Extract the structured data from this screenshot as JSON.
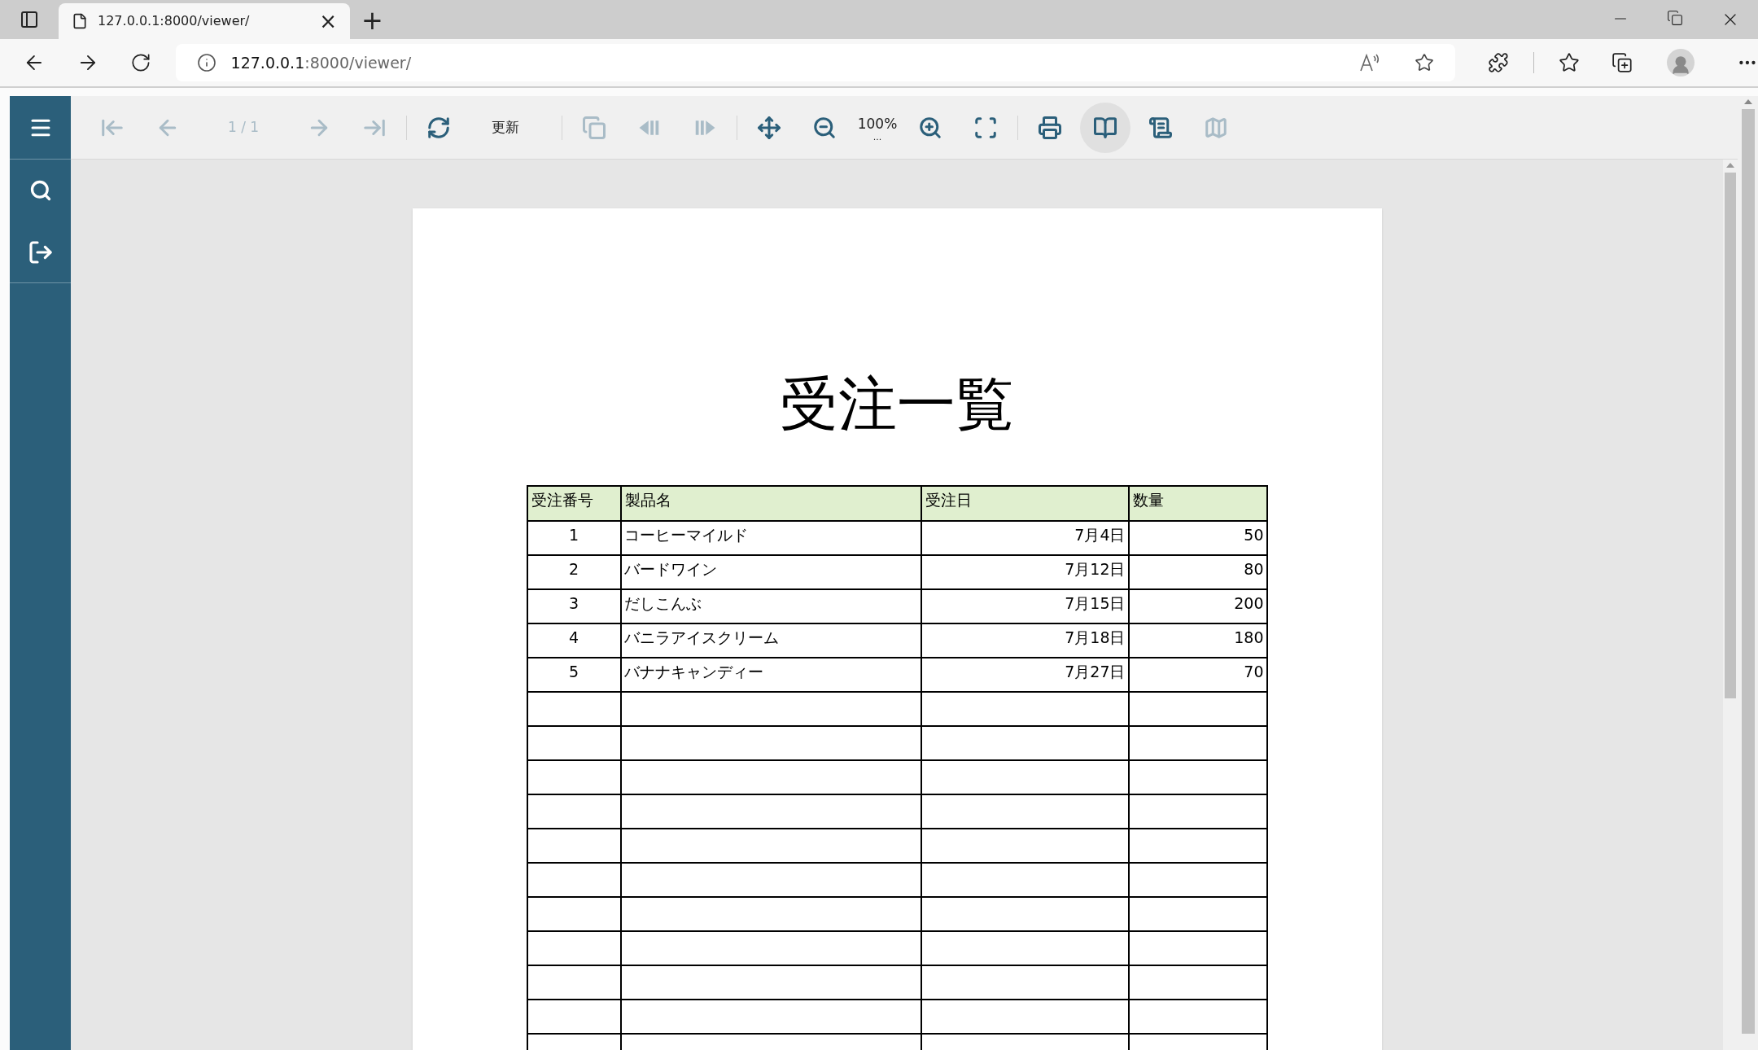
{
  "browser": {
    "tab_title": "127.0.0.1:8000/viewer/",
    "tab_close": "×",
    "new_tab": "+",
    "address": {
      "host": "127.0.0.1",
      "path": ":8000/viewer/"
    }
  },
  "toolbar_groups": [
    [
      {
        "kind": "icon",
        "disabled": true
      },
      {
        "kind": "icon",
        "disabled": true
      },
      {
        "kind": "page",
        "text": "1 / 1",
        "disabled": true
      },
      {
        "kind": "icon",
        "disabled": true
      },
      {
        "kind": "icon",
        "disabled": true
      }
    ],
    [
      {
        "kind": "icon",
        "disabled": false
      },
      {
        "kind": "label",
        "text": "更新"
      }
    ],
    [
      {
        "kind": "icon",
        "disabled": true
      },
      {
        "kind": "icon",
        "disabled": true
      },
      {
        "kind": "icon",
        "disabled": true
      }
    ],
    [
      {
        "kind": "icon",
        "disabled": false
      },
      {
        "kind": "icon",
        "disabled": false
      },
      {
        "kind": "zoom",
        "text": "100%",
        "menu": "..."
      },
      {
        "kind": "icon",
        "disabled": false
      },
      {
        "kind": "icon",
        "disabled": false
      }
    ],
    [
      {
        "kind": "icon",
        "disabled": false,
        "selected": false
      },
      {
        "kind": "icon",
        "disabled": false,
        "selected": true
      },
      {
        "kind": "icon",
        "disabled": false,
        "selected": false
      },
      {
        "kind": "icon",
        "disabled": true,
        "selected": false
      }
    ]
  ],
  "report": {
    "title": "受注一覧",
    "columns": [
      {
        "label": "受注番号"
      },
      {
        "label": "製品名"
      },
      {
        "label": "受注日"
      },
      {
        "label": "数量"
      }
    ],
    "rows": [
      [
        "1",
        "コーヒーマイルド",
        "7月4日",
        "50"
      ],
      [
        "2",
        "バードワイン",
        "7月12日",
        "80"
      ],
      [
        "3",
        "だしこんぶ",
        "7月15日",
        "200"
      ],
      [
        "4",
        "バニラアイスクリーム",
        "7月18日",
        "180"
      ],
      [
        "5",
        "バナナキャンディー",
        "7月27日",
        "70"
      ]
    ]
  }
}
